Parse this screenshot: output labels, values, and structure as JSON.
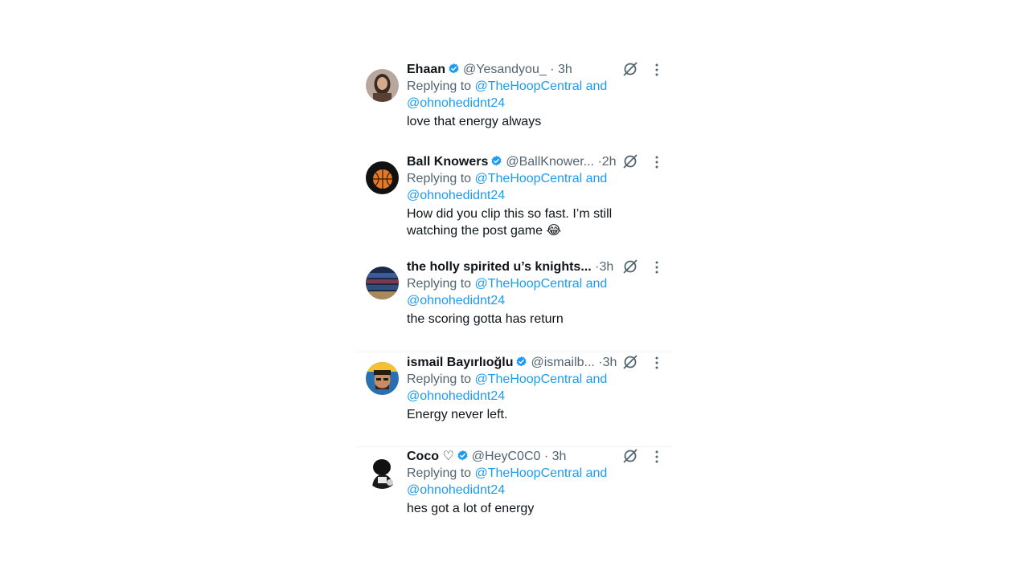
{
  "replies": [
    {
      "name": "Ehaan",
      "verified": true,
      "handle": "@Yesandyou_",
      "time": "3h",
      "replying_prefix": "Replying to",
      "mention_line1": "@TheHoopCentral and",
      "mention_line2": "@ohnohedidnt24",
      "text": "love that energy always",
      "avatar_icon": "woman-portrait-avatar"
    },
    {
      "name": "Ball Knowers",
      "verified": true,
      "handle": "@BallKnower...",
      "time": "2h",
      "replying_prefix": "Replying to",
      "mention_line1": "@TheHoopCentral and",
      "mention_line2": "@ohnohedidnt24",
      "text_line1": "How did you clip this so fast. I’m still",
      "text_line2": "watching the post game 😂",
      "avatar_icon": "basketball-avatar"
    },
    {
      "name": "the holly spirited u’s knights...",
      "verified": false,
      "handle": "",
      "time": "3h",
      "replying_prefix": "Replying to",
      "mention_line1": "@TheHoopCentral and",
      "mention_line2": "@ohnohedidnt24",
      "text": "the scoring gotta has return",
      "avatar_icon": "arena-avatar"
    },
    {
      "name": "ismail Bayırlıoğlu",
      "verified": true,
      "handle": "@ismailb...",
      "time": "3h",
      "replying_prefix": "Replying to",
      "mention_line1": "@TheHoopCentral and",
      "mention_line2": "@ohnohedidnt24",
      "text": "Energy never left.",
      "avatar_icon": "man-portrait-avatar"
    },
    {
      "name": "Coco ♡",
      "verified": true,
      "handle": "@HeyC0C0",
      "time": "3h",
      "replying_prefix": "Replying to",
      "mention_line1": "@TheHoopCentral and",
      "mention_line2": "@ohnohedidnt24",
      "text": "hes got a lot of energy",
      "avatar_icon": "black-white-figure-avatar"
    }
  ],
  "colors": {
    "link": "#1d9bf0",
    "secondary_text": "#536471",
    "primary_text": "#0f1419",
    "verified_badge": "#1d9bf0",
    "divider": "#eff3f4"
  },
  "icons": {
    "grok": "grok-icon",
    "more": "more-options-icon",
    "verified": "verified-badge-icon"
  }
}
